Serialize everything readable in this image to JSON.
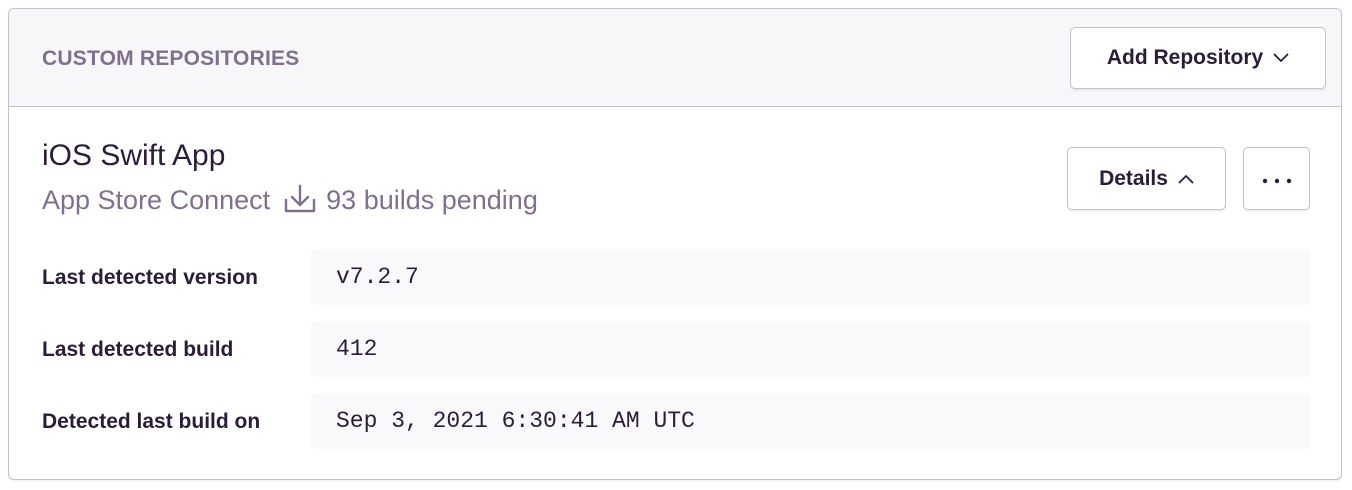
{
  "header": {
    "title": "CUSTOM REPOSITORIES",
    "add_button_label": "Add Repository"
  },
  "repository": {
    "name": "iOS Swift App",
    "source": "App Store Connect",
    "pending": "93 builds pending",
    "details_button_label": "Details",
    "more_button_label": "···"
  },
  "details": {
    "rows": [
      {
        "label": "Last detected version",
        "value": "v7.2.7"
      },
      {
        "label": "Last detected build",
        "value": "412"
      },
      {
        "label": "Detected last build on",
        "value": "Sep 3, 2021 6:30:41 AM UTC"
      }
    ]
  },
  "icons": {
    "chevron_down": "chevron-down-icon",
    "chevron_up": "chevron-up-icon",
    "download": "download-icon",
    "ellipsis": "ellipsis-icon"
  },
  "colors": {
    "text_primary": "#2b1d38",
    "text_muted": "#80708f",
    "border": "#c6becf",
    "header_bg": "#f7f6f9",
    "value_bg": "#f9f8fa"
  }
}
